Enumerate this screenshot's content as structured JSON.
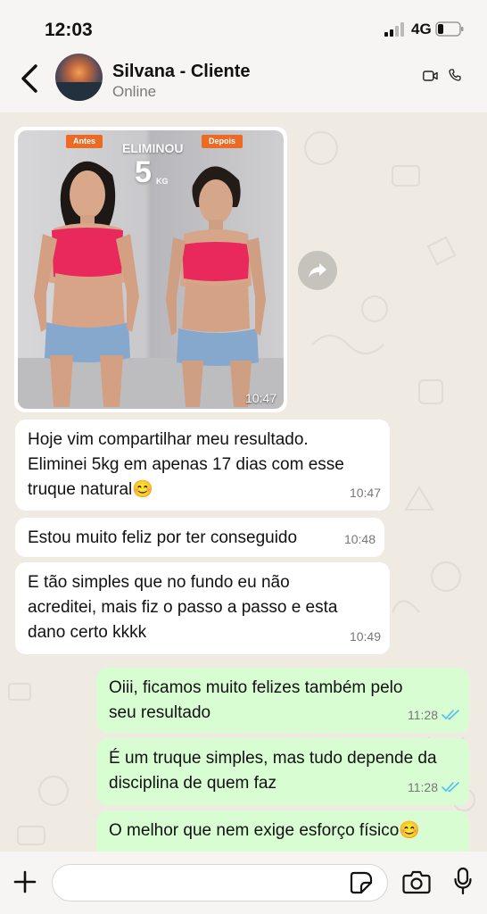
{
  "status_bar": {
    "time": "12:03",
    "network": "4G"
  },
  "header": {
    "contact_name": "Silvana - Cliente",
    "contact_status": "Online"
  },
  "media_message": {
    "label_before": "Antes",
    "label_after": "Depois",
    "headline": "ELIMINOU",
    "amount": "5",
    "unit": "KG",
    "time": "10:47"
  },
  "messages": [
    {
      "direction": "in",
      "text": "Hoje vim compartilhar meu resultado. Eliminei 5kg em apenas 17 dias com esse truque natural😊",
      "time": "10:47"
    },
    {
      "direction": "in",
      "text": "Estou muito feliz por ter conseguido",
      "time": "10:48"
    },
    {
      "direction": "in",
      "text": "E tão simples que no fundo eu não acreditei, mais fiz o passo a passo e esta dano certo kkkk",
      "time": "10:49"
    },
    {
      "direction": "out",
      "text": "Oiii, ficamos muito felizes também pelo seu resultado",
      "time": "11:28",
      "status": "read"
    },
    {
      "direction": "out",
      "text": "É um truque simples, mas tudo depende da disciplina de quem faz",
      "time": "11:28",
      "status": "read"
    },
    {
      "direction": "out",
      "text": "O melhor que nem exige esforço físico😊",
      "time": ""
    }
  ],
  "input": {
    "value": "",
    "placeholder": ""
  },
  "colors": {
    "chat_background": "#efeae2",
    "incoming_bubble": "#ffffff",
    "outgoing_bubble": "#d9fdd3",
    "read_ticks": "#53bdeb",
    "label_orange": "#ec6a24",
    "top_bar": "#f6f5f3"
  },
  "icons": [
    "back-arrow-icon",
    "video-call-icon",
    "phone-icon",
    "forward-icon",
    "plus-icon",
    "sticker-icon",
    "camera-icon",
    "microphone-icon",
    "double-check-icon"
  ]
}
